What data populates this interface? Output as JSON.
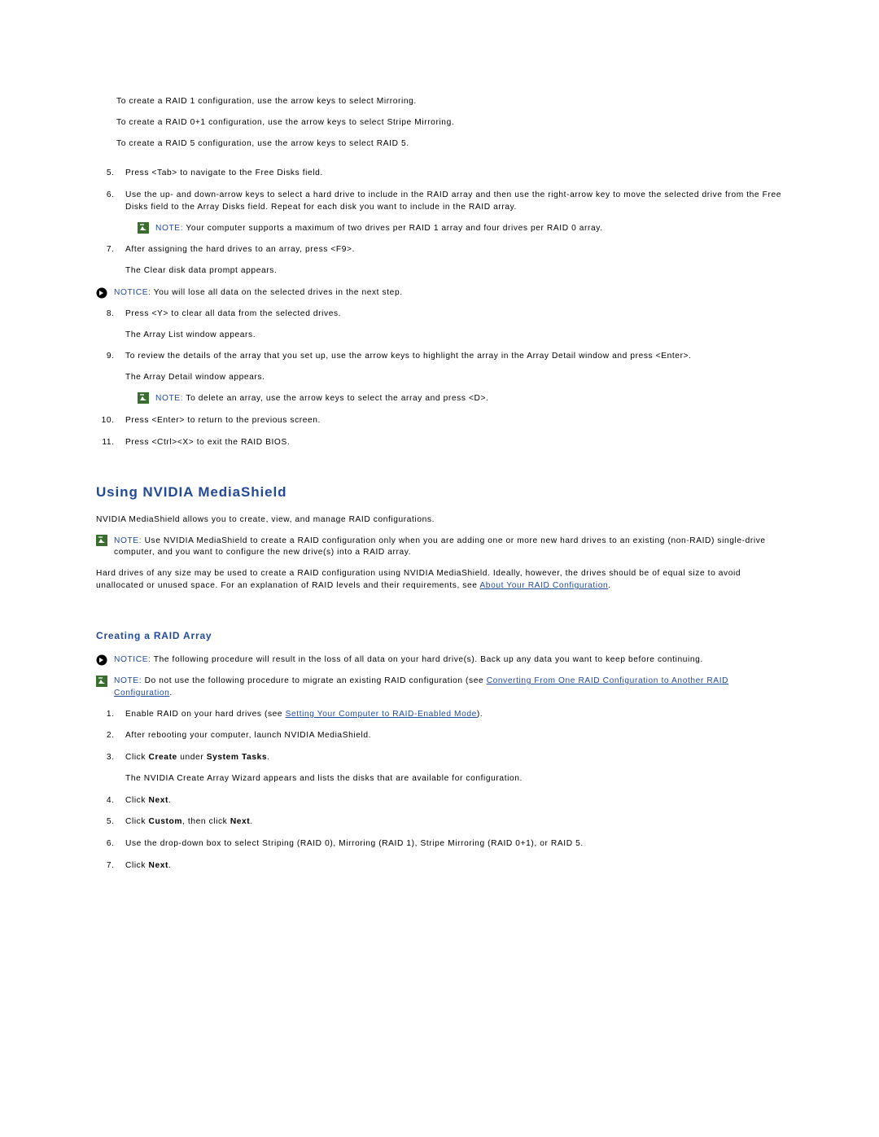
{
  "intro": {
    "raid1": "To create a RAID 1 configuration, use the arrow keys to select Mirroring.",
    "raid01": "To create a RAID 0+1 configuration, use the arrow keys to select Stripe Mirroring.",
    "raid5": "To create a RAID 5 configuration, use the arrow keys to select RAID 5."
  },
  "steps1": {
    "s5": "Press <Tab> to navigate to the Free Disks field.",
    "s6": "Use the up- and down-arrow keys to select a hard drive to include in the RAID array and then use the right-arrow key to move the selected drive from the Free Disks field to the Array Disks field. Repeat for each disk you want to include in the RAID array.",
    "s6_note_label": "NOTE:",
    "s6_note_body": " Your computer supports a maximum of two drives per RAID 1 array and four drives per RAID 0 array.",
    "s7a": "After assigning the hard drives to an array, press <F9>.",
    "s7b": "The Clear disk data prompt appears.",
    "notice1_label": "NOTICE:",
    "notice1_body": " You will lose all data on the selected drives in the next step.",
    "s8a": "Press <Y> to clear all data from the selected drives.",
    "s8b": "The Array List window appears.",
    "s9a": "To review the details of the array that you set up, use the arrow keys to highlight the array in the Array Detail window and press <Enter>.",
    "s9b": "The Array Detail window appears.",
    "s9_note_label": "NOTE:",
    "s9_note_body": " To delete an array, use the arrow keys to select the array and press <D>.",
    "s10": "Press <Enter> to return to the previous screen.",
    "s11": "Press <Ctrl><X> to exit the RAID BIOS."
  },
  "h2": "Using NVIDIA MediaShield",
  "ms_intro": "NVIDIA MediaShield allows you to create, view, and manage RAID configurations.",
  "ms_note_label": "NOTE:",
  "ms_note_body": " Use NVIDIA MediaShield to create a RAID configuration only when you are adding one or more new hard drives to an existing (non-RAID) single-drive computer, and you want to configure the new drive(s) into a RAID array.",
  "ms_para_a": "Hard drives of any size may be used to create a RAID configuration using NVIDIA MediaShield. Ideally, however, the drives should be of equal size to avoid unallocated or unused space. For an explanation of RAID levels and their requirements, see ",
  "ms_para_link": "About Your RAID Configuration",
  "h3": "Creating a RAID Array",
  "cr_notice_label": "NOTICE:",
  "cr_notice_body": " The following procedure will result in the loss of all data on your hard drive(s). Back up any data you want to keep before continuing.",
  "cr_note_label": "NOTE:",
  "cr_note_body_a": " Do not use the following procedure to migrate an existing RAID configuration (see ",
  "cr_note_link": "Converting From One RAID Configuration to Another RAID Configuration",
  "cr_note_body_b": ".",
  "steps2": {
    "s1a": "Enable RAID on your hard drives (see ",
    "s1link": "Setting Your Computer to RAID-Enabled Mode",
    "s1b": ").",
    "s2": "After rebooting your computer, launch NVIDIA MediaShield.",
    "s3a": "Click ",
    "s3b_bold": "Create",
    "s3c": " under ",
    "s3d_bold": "System Tasks",
    "s3e": ".",
    "s3f": "The NVIDIA Create Array Wizard appears and lists the disks that are available for configuration.",
    "s4a": "Click ",
    "s4b_bold": "Next",
    "s4c": ".",
    "s5a": "Click ",
    "s5b_bold": "Custom",
    "s5c": ", then click ",
    "s5d_bold": "Next",
    "s5e": ".",
    "s6": "Use the drop-down box to select Striping (RAID 0), Mirroring (RAID 1), Stripe Mirroring (RAID 0+1), or RAID 5.",
    "s7a": "Click ",
    "s7b_bold": "Next",
    "s7c": "."
  }
}
